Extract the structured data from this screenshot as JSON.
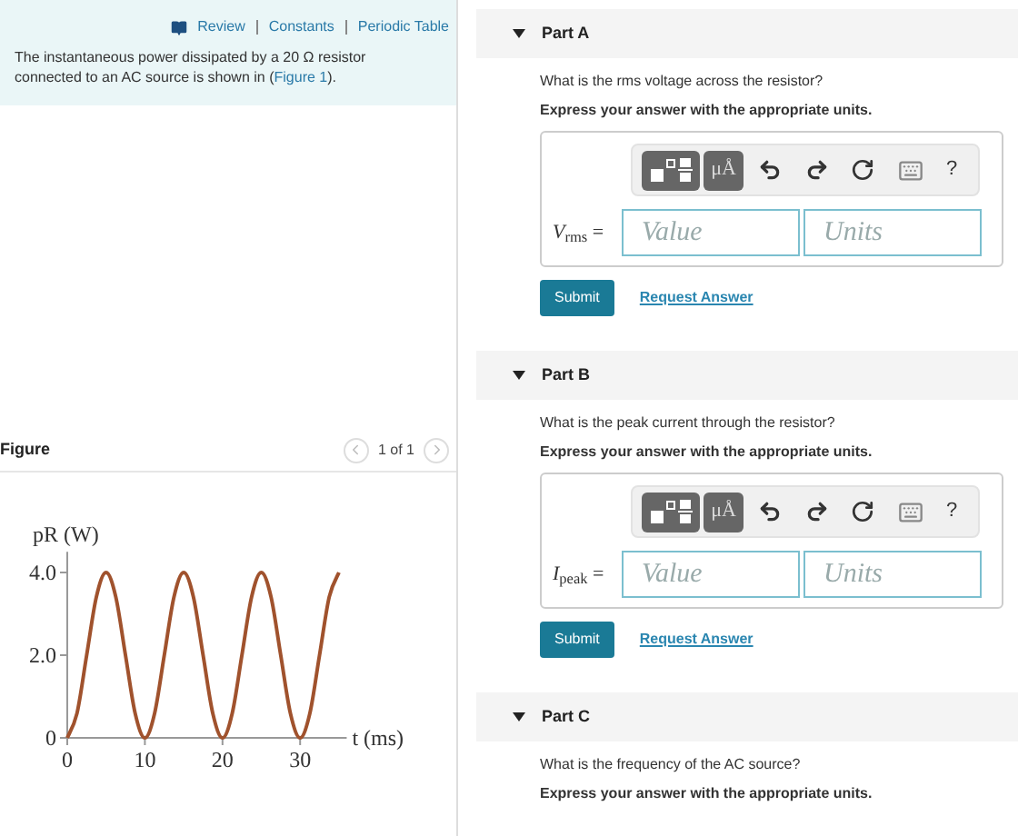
{
  "resources": {
    "links": [
      {
        "label": "Review"
      },
      {
        "label": "Constants"
      },
      {
        "label": "Periodic Table"
      }
    ]
  },
  "intro": {
    "text_before": "The instantaneous power dissipated by a 20 Ω resistor connected to an AC source is shown in (",
    "link": "Figure 1",
    "text_after": ")."
  },
  "figure": {
    "title": "Figure",
    "pager": "1 of 1",
    "chart_data": {
      "type": "line",
      "xlabel": "t (ms)",
      "ylabel": "pR (W)",
      "x": [
        0,
        1.25,
        2.5,
        3.75,
        5,
        6.25,
        7.5,
        8.75,
        10,
        11.25,
        12.5,
        13.75,
        15,
        16.25,
        17.5,
        18.75,
        20,
        21.25,
        22.5,
        23.75,
        25,
        26.25,
        27.5,
        28.75,
        30,
        31.25,
        32.5,
        33.75,
        35
      ],
      "series": [
        {
          "color": "#a0522d",
          "values": [
            0,
            0.59,
            2,
            3.41,
            4,
            3.41,
            2,
            0.59,
            0,
            0.59,
            2,
            3.41,
            4,
            3.41,
            2,
            0.59,
            0,
            0.59,
            2,
            3.41,
            4,
            3.41,
            2,
            0.59,
            0,
            0.59,
            2,
            3.41,
            4
          ]
        }
      ],
      "xlim": [
        0,
        36
      ],
      "ylim": [
        0,
        4.5
      ],
      "xticks": [
        0,
        10,
        20,
        30
      ],
      "yticks": [
        {
          "value": 0,
          "label": "0"
        },
        {
          "value": 2,
          "label": "2.0"
        },
        {
          "value": 4,
          "label": "4.0"
        }
      ]
    }
  },
  "parts": [
    {
      "title": "Part A",
      "expanded": true,
      "question": "What is the rms voltage across the resistor?",
      "instruction": "Express your answer with the appropriate units.",
      "answer": {
        "label": "*V*$_{rms}$ =",
        "units_button": "μÅ",
        "help": "?",
        "value_placeholder": "Value",
        "units_placeholder": "Units"
      },
      "submit": "Submit",
      "request": "Request Answer"
    },
    {
      "title": "Part B",
      "expanded": true,
      "question": "What is the peak current through the resistor?",
      "instruction": "Express your answer with the appropriate units.",
      "answer": {
        "label": "*I*$_{peak}$ =",
        "units_button": "μÅ",
        "help": "?",
        "value_placeholder": "Value",
        "units_placeholder": "Units"
      },
      "submit": "Submit",
      "request": "Request Answer"
    },
    {
      "title": "Part C",
      "expanded": true,
      "question": "What is the frequency of the AC source?",
      "instruction": "Express your answer with the appropriate units."
    }
  ]
}
